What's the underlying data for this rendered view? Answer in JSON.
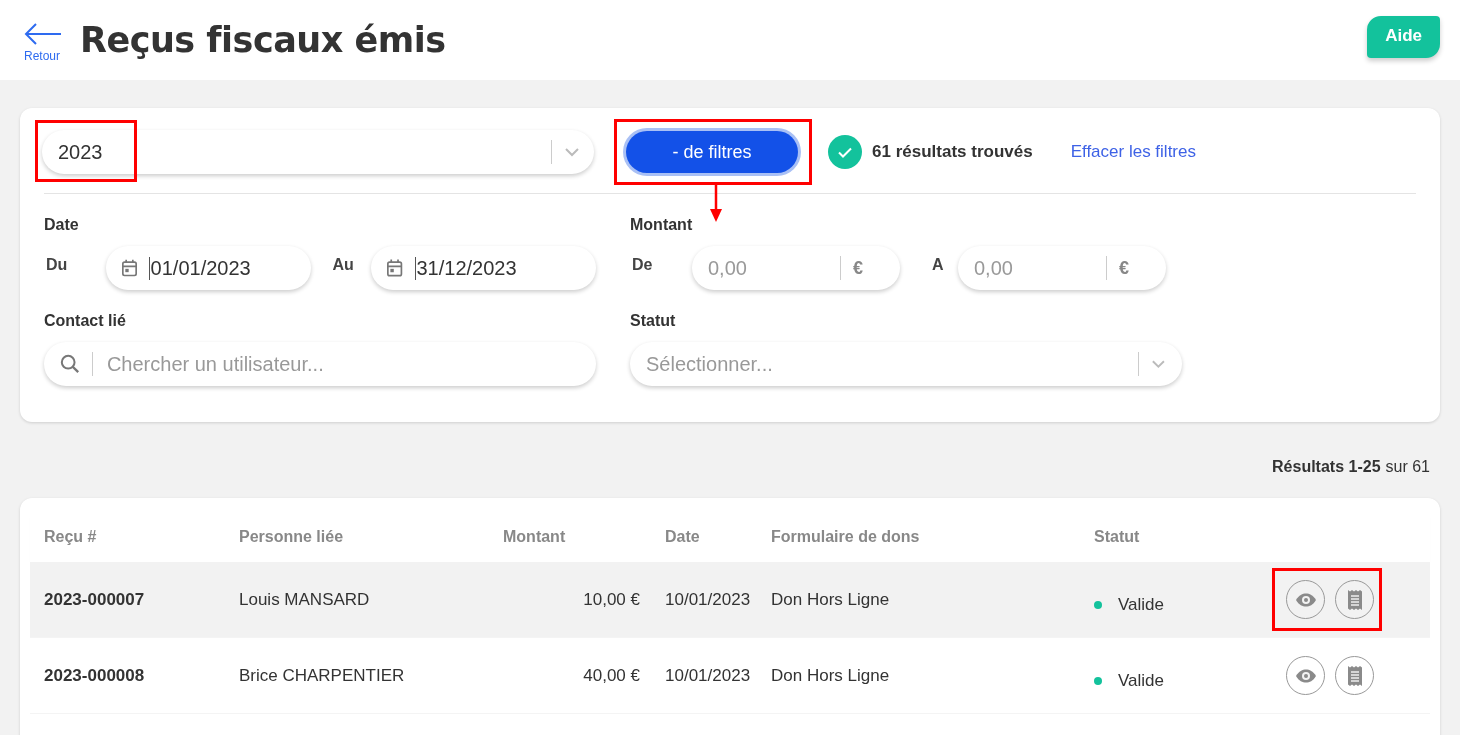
{
  "header": {
    "back_label": "Retour",
    "title": "Reçus fiscaux émis",
    "help_button": "Aide"
  },
  "filters": {
    "year_select": {
      "value": "2023",
      "highlighted": true
    },
    "toggle_button": {
      "label": "- de filtres",
      "highlighted": true
    },
    "result_count": "61 résultats trouvés",
    "clear_link": "Effacer les filtres",
    "date": {
      "label": "Date",
      "from_label": "Du",
      "from_value": "01/01/2023",
      "to_label": "Au",
      "to_value": "31/12/2023"
    },
    "amount": {
      "label": "Montant",
      "from_label": "De",
      "from_placeholder": "0,00",
      "to_label": "A",
      "to_placeholder": "0,00",
      "currency": "€"
    },
    "contact": {
      "label": "Contact lié",
      "placeholder": "Chercher un utilisateur..."
    },
    "status": {
      "label": "Statut",
      "placeholder": "Sélectionner..."
    }
  },
  "pagination": {
    "range": "Résultats 1-25",
    "total": "sur 61"
  },
  "table": {
    "columns": [
      "Reçu #",
      "Personne liée",
      "Montant",
      "Date",
      "Formulaire de dons",
      "Statut"
    ],
    "rows": [
      {
        "receipt": "2023-000007",
        "person": "Louis MANSARD",
        "amount": "10,00 €",
        "date": "10/01/2023",
        "form": "Don Hors Ligne",
        "status": "Valide",
        "color": "#13c29c",
        "hovered": true,
        "highlighted": true
      },
      {
        "receipt": "2023-000008",
        "person": "Brice CHARPENTIER",
        "amount": "40,00 €",
        "date": "10/01/2023",
        "form": "Don Hors Ligne",
        "status": "Valide",
        "color": "#13c29c",
        "hovered": false,
        "highlighted": false
      }
    ]
  }
}
